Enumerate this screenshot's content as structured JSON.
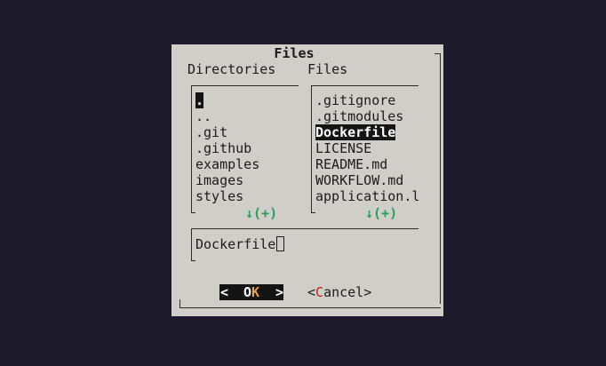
{
  "dialog": {
    "title": "Files",
    "directories_header": "Directories",
    "files_header": "Files"
  },
  "directories": {
    "items": [
      ".",
      "..",
      ".git",
      ".github",
      "examples",
      "images",
      "styles"
    ],
    "selected_index": 0,
    "more_indicator": "↓(+)"
  },
  "files": {
    "items": [
      ".gitignore",
      ".gitmodules",
      "Dockerfile",
      "LICENSE",
      "README.md",
      "WORKFLOW.md",
      "application.l"
    ],
    "selected_index": 2,
    "more_indicator": "↓(+)"
  },
  "filename_input": {
    "value": "Dockerfile"
  },
  "buttons": {
    "ok_left": "<",
    "ok_label_pre": "O",
    "ok_label_hot": "K",
    "ok_right": ">",
    "cancel_open": "<",
    "cancel_hot": "C",
    "cancel_rest": "ancel",
    "cancel_close": ">"
  },
  "colors": {
    "background": "#1c1a2b",
    "dialog": "#d0cec9",
    "selection": "#141414",
    "more_indicator": "#2e9c5a",
    "ok_hotkey": "#e2a35c",
    "cancel_hotkey": "#c42020"
  }
}
